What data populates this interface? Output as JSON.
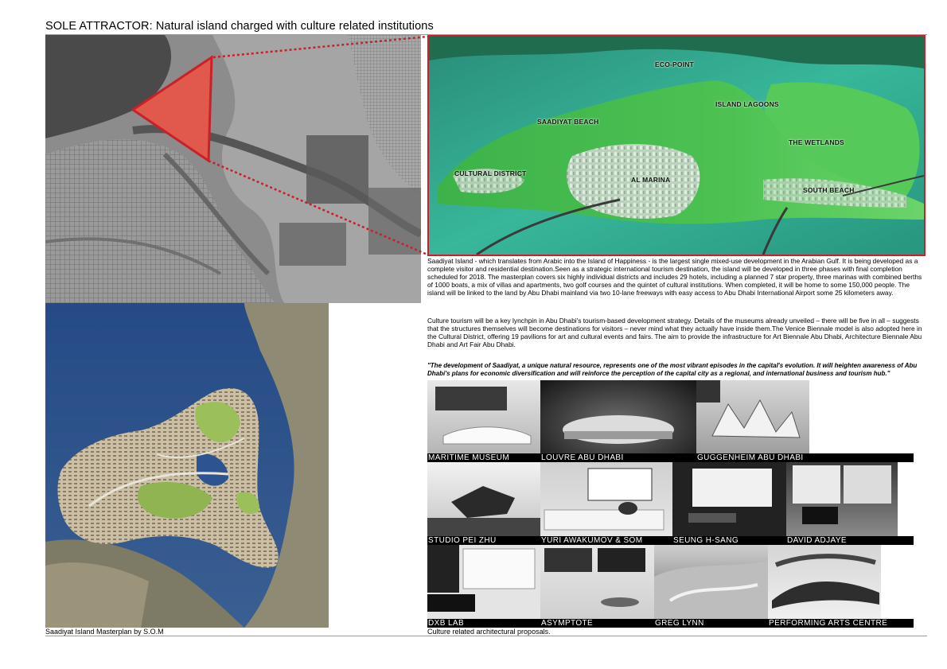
{
  "title": "SOLE ATTRACTOR: Natural island charged with culture related institutions",
  "aerial_labels": {
    "eco_point": "ECO-POINT",
    "island_lagoons": "ISLAND LAGOONS",
    "saadiyat_beach": "SAADIYAT BEACH",
    "the_wetlands": "THE WETLANDS",
    "cultural_district": "CULTURAL DISTRICT",
    "al_marina": "AL MARINA",
    "south_beach": "SOUTH BEACH"
  },
  "paragraph_1": "Saadiyat Island - which translates from Arabic into the Island of Happiness - is the largest single mixed-use development in the Arabian Gulf. It is being developed as a complete visitor and residential destination.Seen as a strategic international tourism destination, the island will be developed in three phases with final completion scheduled for 2018. The masterplan covers six highly individual districts and includes 29 hotels, including a planned 7 star property, three marinas with combined berths of 1000 boats, a mix of villas and apartments, two golf courses and the quintet of cultural institutions. When completed, it will be home to some 150,000 people. The island will be linked to the land by Abu Dhabi mainland via two 10-lane freeways with easy access to Abu Dhabi International Airport some 25 kilometers away.",
  "paragraph_2": "Culture tourism will be a key lynchpin in Abu Dhabi's tourism-based development strategy. Details of the museums already unveiled – there will be five in all – suggests that the structures themselves will become destinations for visitors – never mind what they actually have inside them.The Venice Biennale model is also adopted here in the Cultural District, offering 19 pavilions for art and cultural events and fairs. The aim to provide the infrastructure for Art Biennale Abu Dhabi, Architecture Biennale Abu Dhabi and Art Fair Abu Dhabi.",
  "quote": "\"The development of Saadiyat, a unique natural resource, represents one of the most vibrant episodes in the capital's evolution. It will heighten awareness of Abu Dhabi's plans for economic diversification and will reinforce the perception of the capital city as a regional, and international business and tourism hub.\"",
  "proposals": [
    {
      "label": "MARITIME MUSEUM"
    },
    {
      "label": "LOUVRE ABU DHABI"
    },
    {
      "label": "GUGGENHEIM ABU DHABI"
    },
    {
      "label": "STUDIO PEI ZHU"
    },
    {
      "label": "YURI AWAKUMOV & SOM"
    },
    {
      "label": "SEUNG H-SANG"
    },
    {
      "label": "DAVID ADJAYE"
    },
    {
      "label": "DXB LAB"
    },
    {
      "label": "ASYMPTOTE"
    },
    {
      "label": "GREG LYNN"
    },
    {
      "label": "PERFORMING ARTS CENTRE"
    }
  ],
  "caption_masterplan": "Saadiyat Island Masterplan by S.O.M",
  "caption_proposals": "Culture related architectural proposals.",
  "colors": {
    "highlight_red": "#c9202a",
    "water_blue": "#2c4a78",
    "island_green": "#3fb34a"
  }
}
